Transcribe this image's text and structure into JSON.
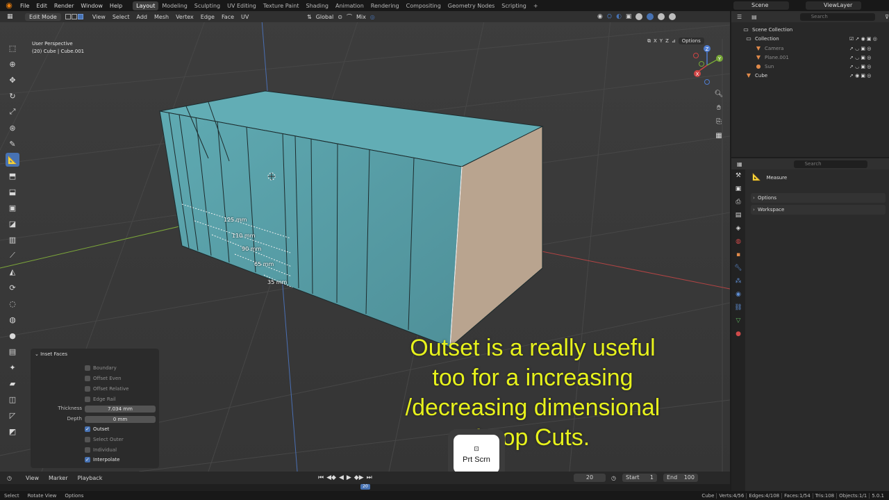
{
  "topbar": {
    "menus": [
      "File",
      "Edit",
      "Render",
      "Window",
      "Help"
    ],
    "workspaces": [
      "Layout",
      "Modeling",
      "Sculpting",
      "UV Editing",
      "Texture Paint",
      "Shading",
      "Animation",
      "Rendering",
      "Compositing",
      "Geometry Nodes",
      "Scripting"
    ],
    "active_workspace": "Layout",
    "scene": "Scene",
    "view_layer": "ViewLayer"
  },
  "viewport_header": {
    "mode": "Edit Mode",
    "menus": [
      "View",
      "Select",
      "Add",
      "Mesh",
      "Vertex",
      "Edge",
      "Face",
      "UV"
    ],
    "orientation": "Global",
    "snap": "Mix"
  },
  "viewport": {
    "view_name": "User Perspective",
    "object_info": "(20) Cube | Cube.001",
    "axes": [
      "X",
      "Y",
      "Z"
    ],
    "options_label": "Options",
    "measurements": [
      "125 mm",
      "110 mm",
      "90 mm",
      "65 mm",
      "35 mm"
    ],
    "gizmo_labels": [
      "Z",
      "Y",
      "X"
    ]
  },
  "operator_panel": {
    "title": "Inset Faces",
    "boundary": "Boundary",
    "offset_even": "Offset Even",
    "offset_relative": "Offset Relative",
    "edge_rail": "Edge Rail",
    "thickness_label": "Thickness",
    "thickness_value": "7.034 mm",
    "depth_label": "Depth",
    "depth_value": "0 mm",
    "outset": "Outset",
    "select_outer": "Select Outer",
    "individual": "Individual",
    "interpolate": "Interpolate"
  },
  "annotation": {
    "lines": [
      "Outset is a really useful",
      "too for a increasing",
      "/decreasing dimensional",
      "Loop Cuts."
    ]
  },
  "keycap": {
    "label": "Prt Scrn"
  },
  "timeline": {
    "menus": [
      "View",
      "Marker",
      "Playback"
    ],
    "current_frame": "20",
    "start_label": "Start",
    "start_value": "1",
    "end_label": "End",
    "end_value": "100",
    "ruler_current": "20"
  },
  "statusbar": {
    "hints": [
      "Select",
      "Rotate View",
      "Options"
    ],
    "stats": [
      "Cube",
      "Verts:4/56",
      "Edges:4/108",
      "Faces:1/54",
      "Tris:108",
      "Objects:1/1",
      "5.0.1"
    ]
  },
  "outliner": {
    "search_placeholder": "Search",
    "rows": [
      {
        "label": "Scene Collection"
      },
      {
        "label": "Collection"
      },
      {
        "label": "Camera"
      },
      {
        "label": "Plane.001"
      },
      {
        "label": "Sun"
      },
      {
        "label": "Cube"
      }
    ]
  },
  "properties": {
    "search_placeholder": "Search",
    "tool_name": "Measure",
    "sections": [
      "Options",
      "Workspace"
    ]
  },
  "colors": {
    "accent": "#4772b3",
    "mesh_face": "#5a9ea6",
    "side_face": "#b9a48f",
    "annotation": "#e7f21c",
    "circle_annotation": "#e21a1a"
  }
}
